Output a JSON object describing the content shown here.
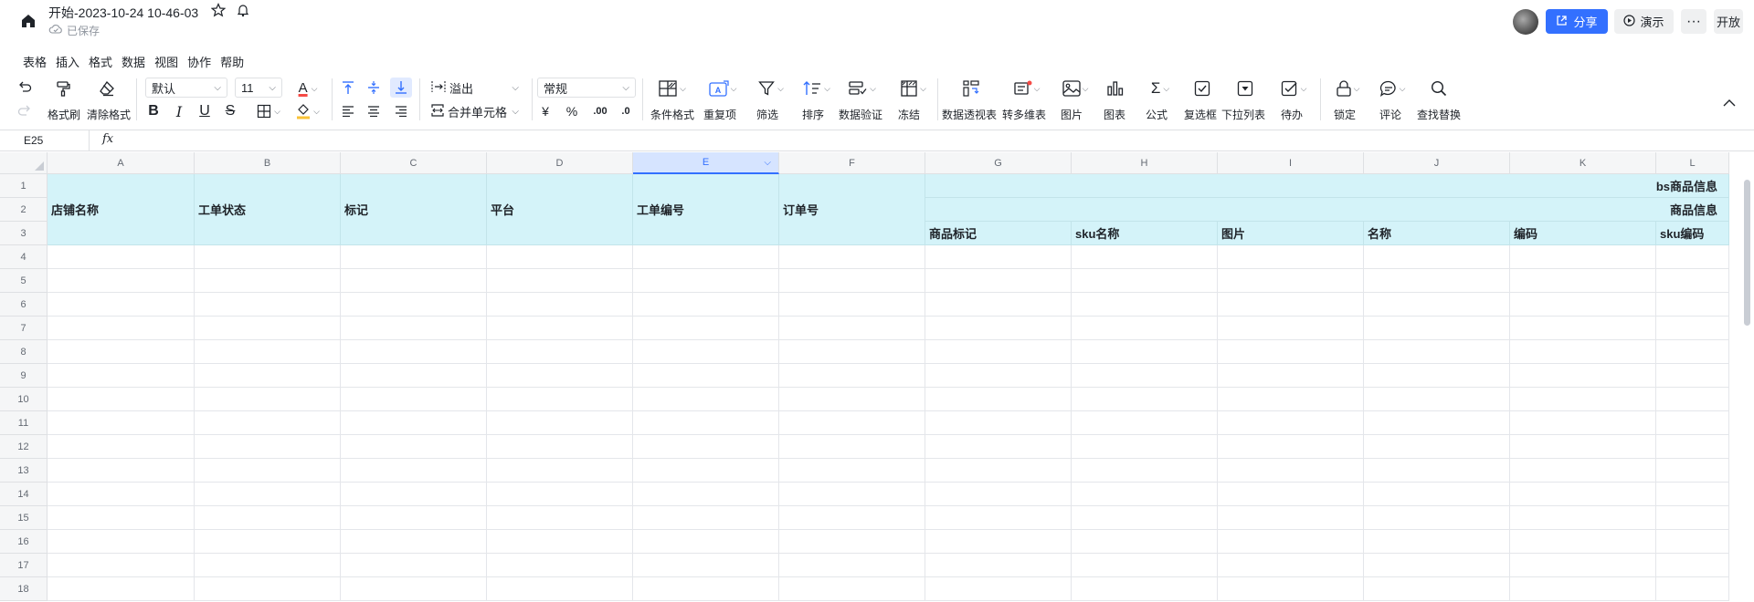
{
  "title_bar": {
    "doc_title": "开始-2023-10-24 10-46-03",
    "save_status": "已保存",
    "share_label": "分享",
    "present_label": "演示",
    "more_label": "···",
    "open_label": "开放"
  },
  "menu": [
    "表格",
    "插入",
    "格式",
    "数据",
    "视图",
    "协作",
    "帮助"
  ],
  "toolbar": {
    "format_painter": "格式刷",
    "clear_format": "清除格式",
    "font_family": "默认",
    "font_size": "11",
    "wrap_mode": "溢出",
    "merge_cells": "合并单元格",
    "number_format": "常规",
    "conditional_format": "条件格式",
    "duplicates": "重复项",
    "filter": "筛选",
    "sort": "排序",
    "data_validation": "数据验证",
    "freeze": "冻结",
    "pivot_table": "数据透视表",
    "to_multi_dim": "转多维表",
    "image": "图片",
    "chart": "图表",
    "formula": "公式",
    "checkbox": "复选框",
    "dropdown": "下拉列表",
    "todo": "待办",
    "lock": "锁定",
    "comment": "评论",
    "find_replace": "查找替换",
    "bold_glyph": "B",
    "italic_glyph": "I",
    "underline_glyph": "U",
    "strike_glyph": "S",
    "text_color_glyph": "A",
    "currency_glyph": "¥",
    "percent_glyph": "%",
    "decimal_glyph": ".00"
  },
  "formula_bar": {
    "cell_ref": "E25",
    "fx": "fx"
  },
  "grid": {
    "columns": [
      "A",
      "B",
      "C",
      "D",
      "E",
      "F",
      "G",
      "H",
      "I",
      "J",
      "K",
      "L"
    ],
    "active_column": "E",
    "rows": [
      "1",
      "2",
      "3",
      "4",
      "5",
      "6",
      "7",
      "8",
      "9",
      "10",
      "11",
      "12",
      "13",
      "14",
      "15",
      "16",
      "17",
      "18"
    ],
    "header_cells": {
      "A": "店铺名称",
      "B": "工单状态",
      "C": "标记",
      "D": "平台",
      "E": "工单编号",
      "F": "订单号",
      "group1": "bs商品信息",
      "group2": "商品信息",
      "G3": "商品标记",
      "H3": "sku名称",
      "I3": "图片",
      "J3": "名称",
      "K3": "编码",
      "L3": "sku编码"
    },
    "header_color": "#d4f3f9"
  }
}
